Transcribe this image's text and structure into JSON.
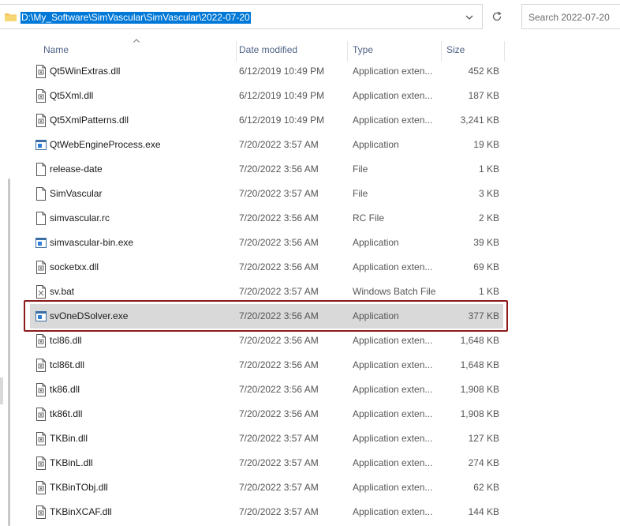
{
  "address": {
    "path": "D:\\My_Software\\SimVascular\\SimVascular\\2022-07-20"
  },
  "search": {
    "placeholder": "Search 2022-07-20"
  },
  "columns": {
    "name": "Name",
    "date": "Date modified",
    "type": "Type",
    "size": "Size"
  },
  "files": [
    {
      "name": "Qt5WinExtras.dll",
      "date": "6/12/2019 10:49 PM",
      "type": "Application exten...",
      "size": "452 KB",
      "icon": "dll-icon"
    },
    {
      "name": "Qt5Xml.dll",
      "date": "6/12/2019 10:49 PM",
      "type": "Application exten...",
      "size": "187 KB",
      "icon": "dll-icon"
    },
    {
      "name": "Qt5XmlPatterns.dll",
      "date": "6/12/2019 10:49 PM",
      "type": "Application exten...",
      "size": "3,241 KB",
      "icon": "dll-icon"
    },
    {
      "name": "QtWebEngineProcess.exe",
      "date": "7/20/2022 3:57 AM",
      "type": "Application",
      "size": "19 KB",
      "icon": "exe-icon"
    },
    {
      "name": "release-date",
      "date": "7/20/2022 3:56 AM",
      "type": "File",
      "size": "1 KB",
      "icon": "file-icon"
    },
    {
      "name": "SimVascular",
      "date": "7/20/2022 3:57 AM",
      "type": "File",
      "size": "3 KB",
      "icon": "file-icon"
    },
    {
      "name": "simvascular.rc",
      "date": "7/20/2022 3:56 AM",
      "type": "RC File",
      "size": "2 KB",
      "icon": "file-icon"
    },
    {
      "name": "simvascular-bin.exe",
      "date": "7/20/2022 3:56 AM",
      "type": "Application",
      "size": "39 KB",
      "icon": "exe-icon"
    },
    {
      "name": "socketxx.dll",
      "date": "7/20/2022 3:56 AM",
      "type": "Application exten...",
      "size": "69 KB",
      "icon": "dll-icon"
    },
    {
      "name": "sv.bat",
      "date": "7/20/2022 3:57 AM",
      "type": "Windows Batch File",
      "size": "1 KB",
      "icon": "bat-icon"
    },
    {
      "name": "svOneDSolver.exe",
      "date": "7/20/2022 3:56 AM",
      "type": "Application",
      "size": "377 KB",
      "icon": "exe-icon",
      "selected": true
    },
    {
      "name": "tcl86.dll",
      "date": "7/20/2022 3:56 AM",
      "type": "Application exten...",
      "size": "1,648 KB",
      "icon": "dll-icon"
    },
    {
      "name": "tcl86t.dll",
      "date": "7/20/2022 3:56 AM",
      "type": "Application exten...",
      "size": "1,648 KB",
      "icon": "dll-icon"
    },
    {
      "name": "tk86.dll",
      "date": "7/20/2022 3:56 AM",
      "type": "Application exten...",
      "size": "1,908 KB",
      "icon": "dll-icon"
    },
    {
      "name": "tk86t.dll",
      "date": "7/20/2022 3:56 AM",
      "type": "Application exten...",
      "size": "1,908 KB",
      "icon": "dll-icon"
    },
    {
      "name": "TKBin.dll",
      "date": "7/20/2022 3:57 AM",
      "type": "Application exten...",
      "size": "127 KB",
      "icon": "dll-icon"
    },
    {
      "name": "TKBinL.dll",
      "date": "7/20/2022 3:57 AM",
      "type": "Application exten...",
      "size": "274 KB",
      "icon": "dll-icon"
    },
    {
      "name": "TKBinTObj.dll",
      "date": "7/20/2022 3:57 AM",
      "type": "Application exten...",
      "size": "62 KB",
      "icon": "dll-icon"
    },
    {
      "name": "TKBinXCAF.dll",
      "date": "7/20/2022 3:57 AM",
      "type": "Application exten...",
      "size": "144 KB",
      "icon": "dll-icon"
    }
  ],
  "colors": {
    "selection_bg": "#d9d9d9",
    "highlight_border": "#8b1a1a",
    "address_highlight": "#0078d7",
    "header_text": "#4d6185"
  }
}
